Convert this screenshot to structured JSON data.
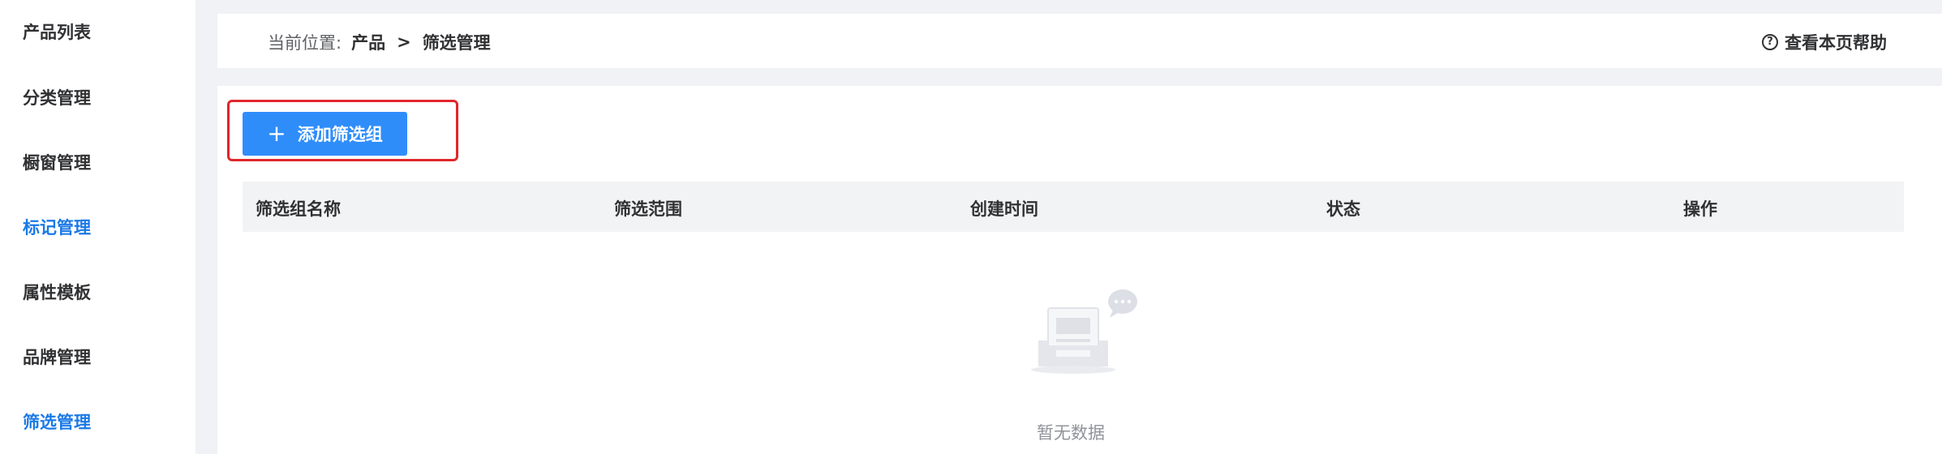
{
  "sidebar": {
    "items": [
      {
        "label": "产品列表",
        "active": false
      },
      {
        "label": "分类管理",
        "active": false
      },
      {
        "label": "橱窗管理",
        "active": false
      },
      {
        "label": "标记管理",
        "active": true
      },
      {
        "label": "属性模板",
        "active": false
      },
      {
        "label": "品牌管理",
        "active": false
      },
      {
        "label": "筛选管理",
        "active": true
      }
    ]
  },
  "breadcrumb": {
    "prefix": "当前位置:",
    "parent": "产品",
    "separator": ">",
    "current": "筛选管理"
  },
  "help": {
    "icon": "question-circle-icon",
    "label": "查看本页帮助"
  },
  "toolbar": {
    "add_icon": "plus-icon",
    "add_label": "添加筛选组"
  },
  "table": {
    "columns": [
      "筛选组名称",
      "筛选范围",
      "创建时间",
      "状态",
      "操作"
    ],
    "rows": []
  },
  "empty_state": {
    "icon": "empty-inbox-icon",
    "text": "暂无数据"
  },
  "colors": {
    "accent": "#2f8dfa",
    "active_nav": "#1b79e6",
    "highlight": "#e0262c"
  }
}
